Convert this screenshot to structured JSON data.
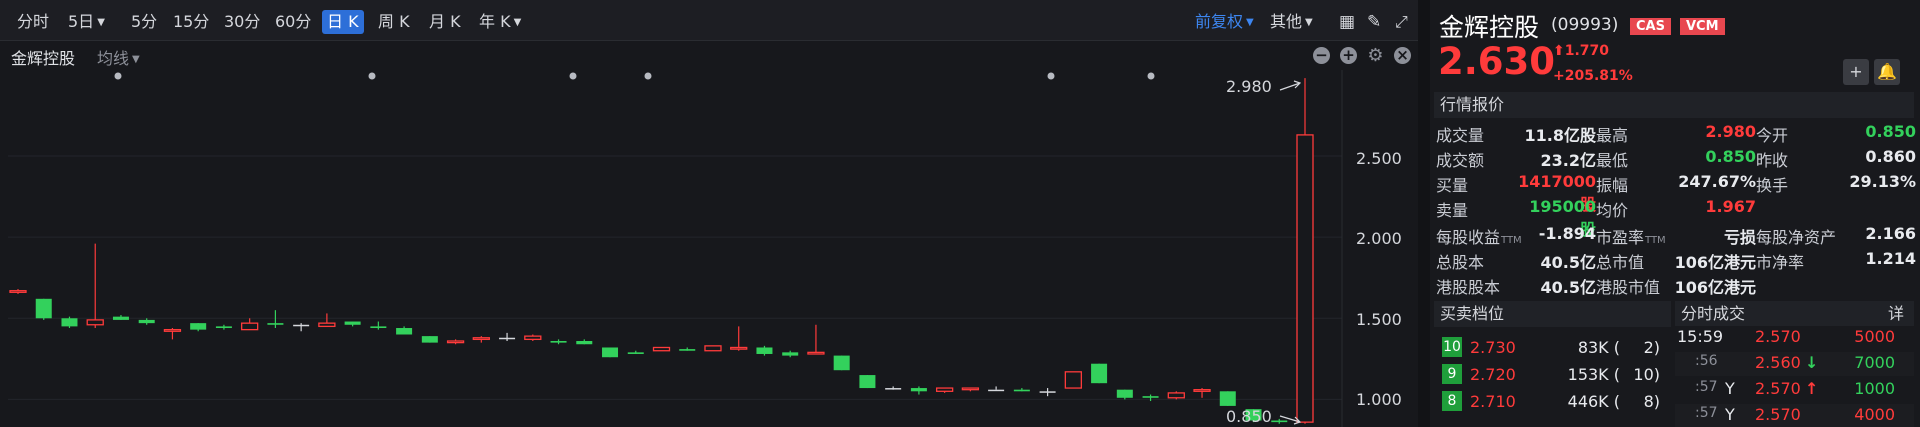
{
  "toolbar": {
    "timeframes": [
      "分时",
      "5日",
      "5分",
      "15分",
      "30分",
      "60分",
      "日 K",
      "周 K",
      "月 K",
      "年 K"
    ],
    "active": "日 K",
    "restore": "前复权",
    "other": "其他"
  },
  "subbar": {
    "stock_name": "金辉控股",
    "ma_label": "均线"
  },
  "colors": {
    "up": "#ff3b3b",
    "down": "#33d15c",
    "accent": "#2d6fd8",
    "badge": "#e8474f"
  },
  "chart_data": {
    "type": "candlestick",
    "y_ticks": [
      "2.500",
      "2.000",
      "1.500",
      "1.000"
    ],
    "ylim": [
      0.83,
      3.03
    ],
    "annotations": {
      "high_label": "2.980",
      "low_label": "0.850"
    },
    "candles": [
      [
        1.66,
        1.68,
        1.65,
        1.67
      ],
      [
        1.62,
        1.62,
        1.49,
        1.5
      ],
      [
        1.5,
        1.51,
        1.44,
        1.45
      ],
      [
        1.46,
        1.96,
        1.44,
        1.49
      ],
      [
        1.51,
        1.52,
        1.49,
        1.49
      ],
      [
        1.49,
        1.5,
        1.46,
        1.47
      ],
      [
        1.42,
        1.44,
        1.37,
        1.43
      ],
      [
        1.47,
        1.47,
        1.42,
        1.43
      ],
      [
        1.45,
        1.46,
        1.43,
        1.44
      ],
      [
        1.43,
        1.5,
        1.43,
        1.47
      ],
      [
        1.47,
        1.55,
        1.44,
        1.46
      ],
      [
        1.46,
        1.47,
        1.42,
        1.46
      ],
      [
        1.45,
        1.53,
        1.45,
        1.47
      ],
      [
        1.48,
        1.48,
        1.45,
        1.46
      ],
      [
        1.45,
        1.48,
        1.43,
        1.44
      ],
      [
        1.44,
        1.45,
        1.41,
        1.4
      ],
      [
        1.39,
        1.39,
        1.35,
        1.35
      ],
      [
        1.35,
        1.37,
        1.34,
        1.36
      ],
      [
        1.37,
        1.39,
        1.35,
        1.38
      ],
      [
        1.38,
        1.41,
        1.36,
        1.38
      ],
      [
        1.37,
        1.4,
        1.36,
        1.39
      ],
      [
        1.36,
        1.37,
        1.34,
        1.35
      ],
      [
        1.36,
        1.37,
        1.34,
        1.34
      ],
      [
        1.32,
        1.32,
        1.26,
        1.26
      ],
      [
        1.29,
        1.3,
        1.28,
        1.28
      ],
      [
        1.3,
        1.32,
        1.3,
        1.32
      ],
      [
        1.31,
        1.32,
        1.3,
        1.3
      ],
      [
        1.3,
        1.33,
        1.3,
        1.33
      ],
      [
        1.31,
        1.45,
        1.3,
        1.32
      ],
      [
        1.32,
        1.33,
        1.27,
        1.28
      ],
      [
        1.29,
        1.3,
        1.26,
        1.27
      ],
      [
        1.28,
        1.46,
        1.28,
        1.29
      ],
      [
        1.27,
        1.27,
        1.18,
        1.18
      ],
      [
        1.15,
        1.15,
        1.07,
        1.07
      ],
      [
        1.07,
        1.08,
        1.06,
        1.07
      ],
      [
        1.07,
        1.08,
        1.03,
        1.05
      ],
      [
        1.05,
        1.07,
        1.04,
        1.07
      ],
      [
        1.06,
        1.07,
        1.05,
        1.07
      ],
      [
        1.06,
        1.08,
        1.06,
        1.06
      ],
      [
        1.06,
        1.07,
        1.05,
        1.05
      ],
      [
        1.05,
        1.07,
        1.02,
        1.05
      ],
      [
        1.07,
        1.17,
        1.07,
        1.17
      ],
      [
        1.22,
        1.22,
        1.1,
        1.1
      ],
      [
        1.06,
        1.06,
        1.0,
        1.01
      ],
      [
        1.02,
        1.03,
        0.99,
        1.01
      ],
      [
        1.01,
        1.05,
        1.0,
        1.04
      ],
      [
        1.05,
        1.07,
        1.01,
        1.06
      ],
      [
        1.05,
        1.05,
        0.96,
        0.96
      ],
      [
        0.94,
        0.94,
        0.86,
        0.87
      ],
      [
        0.87,
        0.88,
        0.85,
        0.86
      ],
      [
        0.86,
        2.98,
        0.85,
        2.63
      ]
    ]
  },
  "quote": {
    "name": "金辉控股",
    "code": "(09993)",
    "badges": [
      "CAS",
      "VCM"
    ],
    "price": "2.630",
    "change": "1.770",
    "change_pct": "+205.81%",
    "section_title": "行情报价",
    "rows": [
      [
        {
          "k": "成交量",
          "v": "11.8亿股",
          "c": "white"
        },
        {
          "k": "最高",
          "v": "2.980",
          "c": "red"
        },
        {
          "k": "今开",
          "v": "0.850",
          "c": "green"
        }
      ],
      [
        {
          "k": "成交额",
          "v": "23.2亿",
          "c": "white"
        },
        {
          "k": "最低",
          "v": "0.850",
          "c": "green"
        },
        {
          "k": "昨收",
          "v": "0.860",
          "c": "white"
        }
      ],
      [
        {
          "k": "买量",
          "v": "1417000股",
          "c": "red"
        },
        {
          "k": "振幅",
          "v": "247.67%",
          "c": "white"
        },
        {
          "k": "换手",
          "v": "29.13%",
          "c": "white"
        }
      ],
      [
        {
          "k": "卖量",
          "v": "195000股",
          "c": "green"
        },
        {
          "k": "均价",
          "v": "1.967",
          "c": "red"
        },
        {
          "k": "",
          "v": "",
          "c": "white"
        }
      ]
    ],
    "rows2": [
      [
        {
          "k": "每股收益",
          "sub": "TTM",
          "v": "-1.894",
          "c": "white"
        },
        {
          "k": "市盈率",
          "sub": "TTM",
          "v": "亏损",
          "c": "white"
        },
        {
          "k": "每股净资产",
          "sub": "",
          "v": "2.166",
          "c": "white"
        }
      ],
      [
        {
          "k": "总股本",
          "sub": "",
          "v": "40.5亿",
          "c": "white"
        },
        {
          "k": "总市值",
          "sub": "",
          "v": "106亿港元",
          "c": "white"
        },
        {
          "k": "市净率",
          "sub": "",
          "v": "1.214",
          "c": "white"
        }
      ],
      [
        {
          "k": "港股股本",
          "sub": "",
          "v": "40.5亿",
          "c": "white"
        },
        {
          "k": "港股市值",
          "sub": "",
          "v": "106亿港元",
          "c": "white"
        },
        {
          "k": "",
          "sub": "",
          "v": "",
          "c": "white"
        }
      ]
    ],
    "orderbook_title": "买卖档位",
    "orderbook": [
      {
        "level": "10",
        "price": "2.730",
        "vol": "83K (",
        "cnt": "2)"
      },
      {
        "level": "9",
        "price": "2.720",
        "vol": "153K (",
        "cnt": "10)"
      },
      {
        "level": "8",
        "price": "2.710",
        "vol": "446K (",
        "cnt": "8)"
      }
    ],
    "trades_title": "分时成交",
    "trades_detail": "详",
    "trades": [
      {
        "time": "15:59",
        "flag": "",
        "price": "2.570",
        "arrow": "",
        "pc": "red",
        "vol": "5000",
        "vc": "red"
      },
      {
        "time": ":56",
        "flag": "",
        "price": "2.560",
        "arrow": "↓",
        "pc": "red",
        "vol": "7000",
        "vc": "green"
      },
      {
        "time": ":57",
        "flag": "Y",
        "price": "2.570",
        "arrow": "↑",
        "pc": "red",
        "vol": "1000",
        "vc": "green"
      },
      {
        "time": ":57",
        "flag": "Y",
        "price": "2.570",
        "arrow": "",
        "pc": "red",
        "vol": "4000",
        "vc": "red"
      }
    ]
  }
}
